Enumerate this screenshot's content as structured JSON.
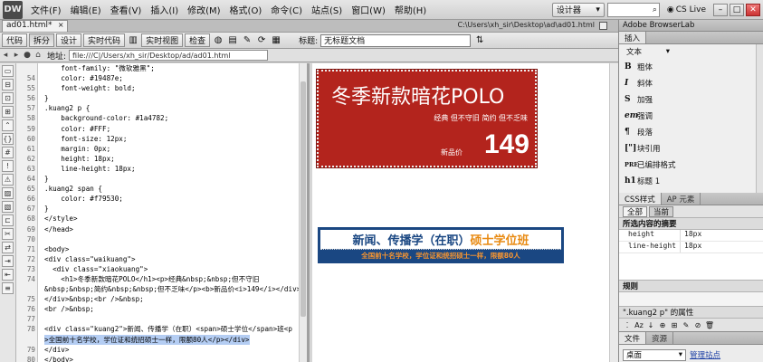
{
  "app": {
    "logo": "DW",
    "menus": [
      "文件(F)",
      "编辑(E)",
      "查看(V)",
      "插入(I)",
      "修改(M)",
      "格式(O)",
      "命令(C)",
      "站点(S)",
      "窗口(W)",
      "帮助(H)"
    ],
    "workspace": "设计器",
    "cs_live": "CS Live"
  },
  "document": {
    "tab_label": "ad01.html*",
    "file_path": "C:\\Users\\xh_sir\\Desktop\\ad\\ad01.html",
    "toolbar": {
      "code": "代码",
      "split": "拆分",
      "design": "设计",
      "live_code": "实时代码",
      "live_view": "实时视图",
      "inspect": "检查",
      "title_label": "标题:",
      "title_value": "无标题文档"
    },
    "address_label": "地址:",
    "address_value": "file:///C|/Users/xh_sir/Desktop/ad/ad01.html"
  },
  "code": {
    "lines": [
      {
        "n": "",
        "t": "    font-family: \"微软雅黑\";"
      },
      {
        "n": "54",
        "t": "    color: #19487e;"
      },
      {
        "n": "55",
        "t": "    font-weight: bold;"
      },
      {
        "n": "56",
        "t": "}"
      },
      {
        "n": "57",
        "t": ".kuang2 p {"
      },
      {
        "n": "58",
        "t": "    background-color: #1a4782;"
      },
      {
        "n": "59",
        "t": "    color: #FFF;"
      },
      {
        "n": "60",
        "t": "    font-size: 12px;"
      },
      {
        "n": "61",
        "t": "    margin: 0px;"
      },
      {
        "n": "62",
        "t": "    height: 18px;"
      },
      {
        "n": "63",
        "t": "    line-height: 18px;"
      },
      {
        "n": "64",
        "t": "}"
      },
      {
        "n": "65",
        "t": ".kuang2 span {"
      },
      {
        "n": "66",
        "t": "    color: #f79530;"
      },
      {
        "n": "67",
        "t": "}"
      },
      {
        "n": "68",
        "t": "</style>"
      },
      {
        "n": "69",
        "t": "</head>"
      },
      {
        "n": "70",
        "t": ""
      },
      {
        "n": "71",
        "t": "<body>"
      },
      {
        "n": "72",
        "t": "<div class=\"waikuang\">"
      },
      {
        "n": "73",
        "t": "  <div class=\"xiaokuang\">"
      },
      {
        "n": "74",
        "t": "    <h1>冬季新款暗花POLO</h1><p>经典&nbsp;&nbsp;但不守旧"
      },
      {
        "n": "",
        "t": "&nbsp;&nbsp;简约&nbsp;&nbsp;但不乏味</p><b>新品价<i>149</i></div>"
      },
      {
        "n": "75",
        "t": "</div>&nbsp;<br />&nbsp;"
      },
      {
        "n": "76",
        "t": "<br />&nbsp;"
      },
      {
        "n": "77",
        "t": ""
      },
      {
        "n": "78",
        "t": "<div class=\"kuang2\">新闻、传播学（在职）<span>硕士学位</span>班<p"
      },
      {
        "n": "",
        "t": ">全国前十名学校，学位证和统招硕士一样，限额80人</p></div>",
        "sel": true
      },
      {
        "n": "79",
        "t": "</div>"
      },
      {
        "n": "80",
        "t": "</body>"
      },
      {
        "n": "81",
        "t": "</html>"
      }
    ]
  },
  "design": {
    "ad1": {
      "title": "冬季新款暗花POLO",
      "subtitle": "经典  但不守旧  简约  但不乏味",
      "price_label": "新品价",
      "price": "149"
    },
    "ad2": {
      "title_before": "新闻、传播学（在职）",
      "title_highlight": "硕士学位班",
      "subline": "全国前十名学校，学位证和统招硕士一样，限额80人"
    }
  },
  "panels": {
    "browserlab": "Adobe BrowserLab",
    "insert_tab": "插入",
    "insert_category": "文本",
    "insert_items": [
      {
        "icon": "B",
        "label": "粗体"
      },
      {
        "icon": "I",
        "label": "斜体"
      },
      {
        "icon": "S",
        "label": "加强"
      },
      {
        "icon": "em",
        "label": "强调"
      },
      {
        "icon": "¶",
        "label": "段落"
      },
      {
        "icon": "[\"]",
        "label": "块引用"
      },
      {
        "icon": "PRE",
        "label": "已编排格式"
      },
      {
        "icon": "h1",
        "label": "标题 1"
      }
    ],
    "css_tabs": [
      "CSS样式",
      "AP 元素"
    ],
    "css_modes": [
      "全部",
      "当前"
    ],
    "selected_summary": "所选内容的摘要",
    "props": [
      {
        "k": "height",
        "v": "18px"
      },
      {
        "k": "line-height",
        "v": "18px"
      }
    ],
    "rules_label": "规则",
    "props_of": "\".kuang2 p\" 的属性",
    "files_tabs": [
      "文件",
      "资源"
    ],
    "site": "桌面",
    "manage_sites": "管理站点"
  }
}
